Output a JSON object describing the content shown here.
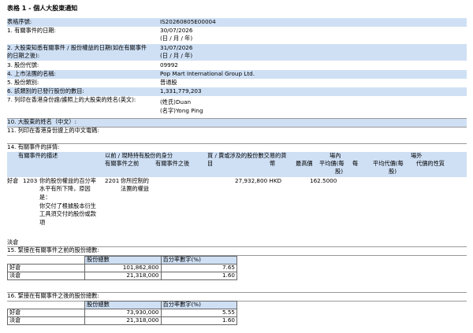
{
  "page_title": "表格 1 - 個人大股東通知",
  "fields": [
    {
      "label": "表格序號:",
      "value": "IS20260805E00004"
    },
    {
      "label": "1. 有關事件的日期:",
      "value": "30/07/2026",
      "note": "(日 / 月 / 年)"
    },
    {
      "label": "2. 大股東知悉有關事件 / 股份權益的日期(如在有關事件",
      "label2": "的日期之後):",
      "value": "31/07/2026",
      "note": "(日 / 月 / 年)"
    },
    {
      "label": "3. 股份代號:",
      "value": "09992"
    },
    {
      "label": "4. 上市法團的名稱:",
      "value": "Pop Mart International Group Ltd."
    },
    {
      "label": "5. 股份類別:",
      "value": "普通股"
    },
    {
      "label": "6. 該類別的已發行股份的數目:",
      "value": "1,331,779,203"
    },
    {
      "label": "7. 列印在香港身份證/護照上的大股東的姓名(英文):",
      "value": "(姓氏)Duan",
      "value2": "(名字)Yong Ping"
    }
  ],
  "section10": {
    "label": "10. 大股東的姓名（中文）:",
    "label11": "11. 列印在香港身份證上的中文電碼:"
  },
  "section14": {
    "label": "14. 有關事件的詳情:",
    "headers": {
      "event_desc": "有關事件的描述",
      "pos_before_after": "以前 / 現時持有股份的身分",
      "before": "有關事件之前",
      "after": "有關事件之後",
      "buy_sell": "買 / 賣或涉及的股份數交易的貨",
      "buy_sell2": "幣",
      "onex": "場內",
      "high": "最高價",
      "avg": "(每股)",
      "avg_label": "平均價(每",
      "avg_label2": "股)",
      "offex": "場外",
      "avg_cons": "平均代價(每",
      "avg_cons2": "股)",
      "cons_nature": "代價的性質"
    },
    "row": {
      "long_pos": "好倉",
      "code1": "1203",
      "desc": [
        "你的股份權益的百分率",
        "水平有所下降，原因",
        "是：",
        "你交付了根據股本衍生",
        "工具須交付的股份或款",
        "項"
      ],
      "code2": "2201",
      "capacity": [
        "你所控制的",
        "法團的權益"
      ],
      "shares": "27,932,800 HKD",
      "price": "162.5000"
    },
    "short_pos": "淡倉"
  },
  "section15": {
    "label": "15. 緊接在有關事件之前的股份總數:",
    "h_shares": "股份總數",
    "h_pct": "百分率數字(%)",
    "rows": [
      {
        "type": "好倉",
        "shares": "101,862,800",
        "pct": "7.65"
      },
      {
        "type": "淡倉",
        "shares": "21,318,000",
        "pct": "1.60"
      }
    ]
  },
  "section16": {
    "label": "16. 緊接在有關事件之後的股份總數:",
    "h_shares": "股份總數",
    "h_pct": "百分率數字(%)",
    "rows": [
      {
        "type": "好倉",
        "shares": "73,930,000",
        "pct": "5.55"
      },
      {
        "type": "淡倉",
        "shares": "21,318,000",
        "pct": "1.60"
      }
    ]
  }
}
